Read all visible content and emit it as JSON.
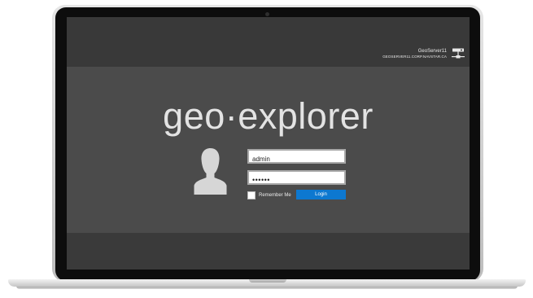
{
  "server": {
    "name": "GeoServer11",
    "host": "GEOSERVER11.CORP.NAVSTAR.CA",
    "icon": "network-server-icon"
  },
  "logo": {
    "text": "geo·explorer"
  },
  "user_icon": "user-silhouette-icon",
  "login_form": {
    "username": {
      "value": "admin",
      "placeholder": ""
    },
    "password": {
      "value": "••••••",
      "placeholder": ""
    },
    "remember_me": {
      "label": "Remember Me",
      "checked": false
    },
    "login_button": {
      "label": "Login",
      "color": "#0d78d0"
    }
  }
}
